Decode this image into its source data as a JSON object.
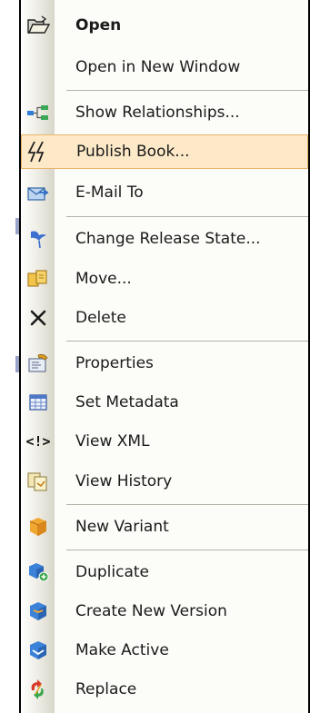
{
  "menu": {
    "items": [
      {
        "label": "Open",
        "icon": "open-folder-icon"
      },
      {
        "label": "Open in New Window",
        "icon": ""
      },
      {
        "label": "Show Relationships...",
        "icon": "relationships-icon"
      },
      {
        "label": "Publish Book...",
        "icon": "publish-lightning-icon"
      },
      {
        "label": "E-Mail To",
        "icon": "email-icon"
      },
      {
        "label": "Change Release State...",
        "icon": "flag-icon"
      },
      {
        "label": "Move...",
        "icon": "move-folder-icon"
      },
      {
        "label": "Delete",
        "icon": "delete-x-icon"
      },
      {
        "label": "Properties",
        "icon": "properties-icon"
      },
      {
        "label": "Set Metadata",
        "icon": "metadata-grid-icon"
      },
      {
        "label": "View XML",
        "icon": "xml-icon"
      },
      {
        "label": "View History",
        "icon": "history-icon"
      },
      {
        "label": "New Variant",
        "icon": "variant-cube-icon"
      },
      {
        "label": "Duplicate",
        "icon": "duplicate-icon"
      },
      {
        "label": "Create New Version",
        "icon": "new-version-icon"
      },
      {
        "label": "Make Active",
        "icon": "make-active-icon"
      },
      {
        "label": "Replace",
        "icon": "replace-arrows-icon"
      }
    ],
    "xml_glyph": "<!>"
  }
}
